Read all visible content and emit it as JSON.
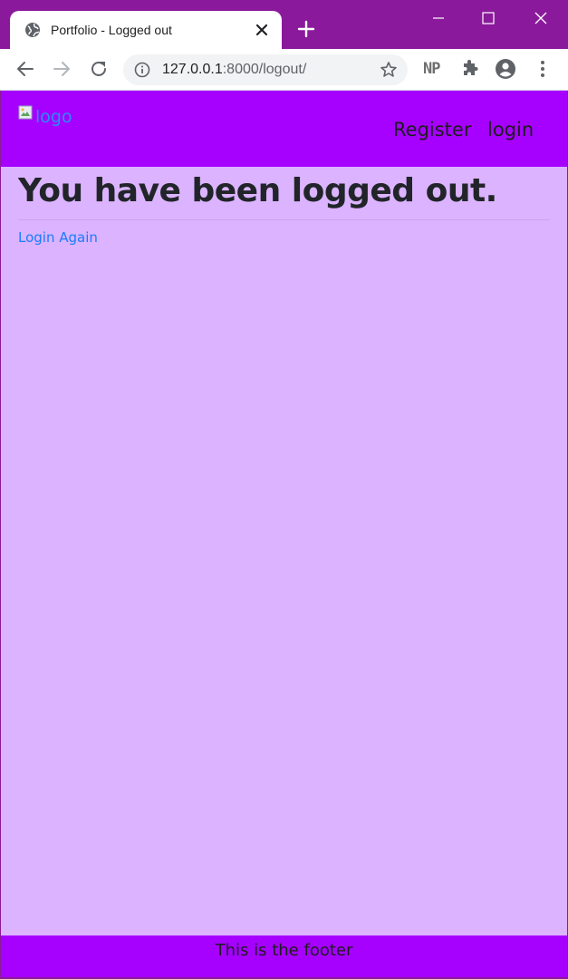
{
  "browser": {
    "tab": {
      "title": "Portfolio - Logged out",
      "favicon": "globe-icon"
    },
    "address_bar": {
      "url_host": "127.0.0.1",
      "url_rest": ":8000/logout/"
    },
    "extension_label": "NP",
    "colors": {
      "frame": "#8a1a9b",
      "toolbar": "#ffffff",
      "omnibox": "#f1f3f4"
    }
  },
  "site": {
    "logo_alt": "logo",
    "nav": {
      "register": "Register",
      "login": "login"
    },
    "heading": "You have been logged out.",
    "login_again_link": "Login Again",
    "footer": "This is the footer",
    "colors": {
      "nav_background": "#a600ff",
      "page_background": "#dbb3ff",
      "link": "#1a7cff",
      "heading": "#212529"
    }
  }
}
